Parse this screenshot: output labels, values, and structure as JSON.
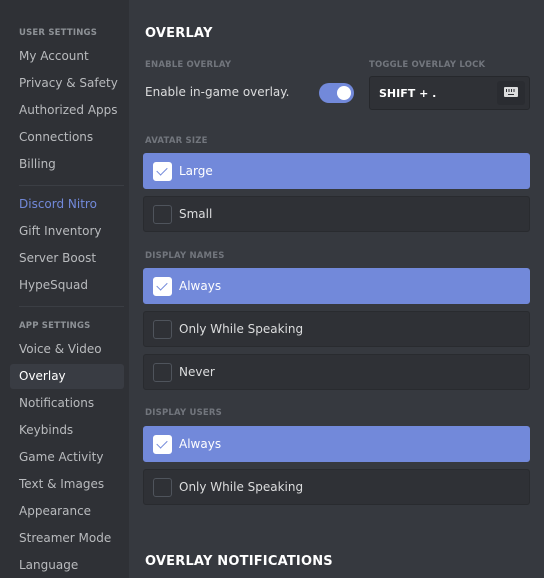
{
  "sidebar": {
    "user_settings_header": "USER SETTINGS",
    "user_items": [
      {
        "label": "My Account"
      },
      {
        "label": "Privacy & Safety"
      },
      {
        "label": "Authorized Apps"
      },
      {
        "label": "Connections"
      },
      {
        "label": "Billing"
      }
    ],
    "nitro_items": [
      {
        "label": "Discord Nitro"
      },
      {
        "label": "Gift Inventory"
      },
      {
        "label": "Server Boost"
      },
      {
        "label": "HypeSquad"
      }
    ],
    "app_settings_header": "APP SETTINGS",
    "app_items": [
      {
        "label": "Voice & Video"
      },
      {
        "label": "Overlay",
        "active": true
      },
      {
        "label": "Notifications"
      },
      {
        "label": "Keybinds"
      },
      {
        "label": "Game Activity"
      },
      {
        "label": "Text & Images"
      },
      {
        "label": "Appearance"
      },
      {
        "label": "Streamer Mode"
      },
      {
        "label": "Language"
      }
    ]
  },
  "main": {
    "title": "OVERLAY",
    "enable_overlay": {
      "label": "ENABLE OVERLAY",
      "text": "Enable in-game overlay.",
      "enabled": true
    },
    "toggle_overlay_lock": {
      "label": "TOGGLE OVERLAY LOCK",
      "keybind": "SHIFT + .",
      "icon": "keyboard-icon"
    },
    "avatar_size": {
      "label": "AVATAR SIZE",
      "options": [
        {
          "label": "Large",
          "selected": true
        },
        {
          "label": "Small",
          "selected": false
        }
      ]
    },
    "display_names": {
      "label": "DISPLAY NAMES",
      "options": [
        {
          "label": "Always",
          "selected": true
        },
        {
          "label": "Only While Speaking",
          "selected": false
        },
        {
          "label": "Never",
          "selected": false
        }
      ]
    },
    "display_users": {
      "label": "DISPLAY USERS",
      "options": [
        {
          "label": "Always",
          "selected": true
        },
        {
          "label": "Only While Speaking",
          "selected": false
        }
      ]
    },
    "notifications_title": "OVERLAY NOTIFICATIONS"
  },
  "colors": {
    "accent": "#7289da",
    "sidebar_bg": "#2f3136",
    "main_bg": "#36393f"
  }
}
